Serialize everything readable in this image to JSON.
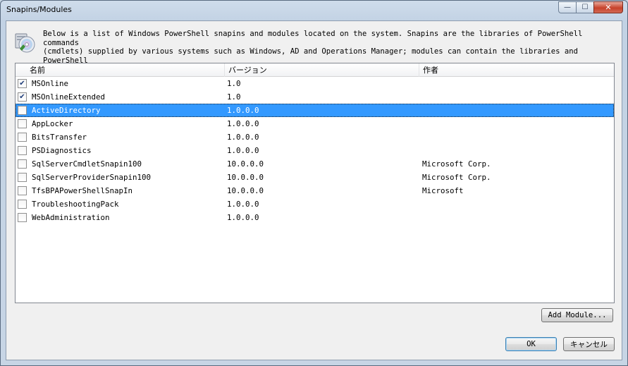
{
  "window": {
    "title": "Snapins/Modules",
    "minimize_glyph": "—",
    "maximize_glyph": "☐",
    "close_glyph": "✕"
  },
  "description": "Below is a list of Windows PowerShell snapins and modules located on the system. Snapins are the libraries of PowerShell commands\n(cmdlets) supplied by various systems such as Windows, AD and Operations Manager; modules can contain the libraries and PowerShell\nscripts as well. Please select the ones you want to be available in the tool.",
  "icon": "snapin-cd-icon",
  "list": {
    "columns": [
      "名前",
      "バージョン",
      "作者"
    ],
    "rows": [
      {
        "name": "MSOnline",
        "version": "1.0",
        "author": "",
        "checked": true,
        "selected": false
      },
      {
        "name": "MSOnlineExtended",
        "version": "1.0",
        "author": "",
        "checked": true,
        "selected": false
      },
      {
        "name": "ActiveDirectory",
        "version": "1.0.0.0",
        "author": "",
        "checked": false,
        "selected": true
      },
      {
        "name": "AppLocker",
        "version": "1.0.0.0",
        "author": "",
        "checked": false,
        "selected": false
      },
      {
        "name": "BitsTransfer",
        "version": "1.0.0.0",
        "author": "",
        "checked": false,
        "selected": false
      },
      {
        "name": "PSDiagnostics",
        "version": "1.0.0.0",
        "author": "",
        "checked": false,
        "selected": false
      },
      {
        "name": "SqlServerCmdletSnapin100",
        "version": "10.0.0.0",
        "author": "Microsoft Corp.",
        "checked": false,
        "selected": false
      },
      {
        "name": "SqlServerProviderSnapin100",
        "version": "10.0.0.0",
        "author": "Microsoft Corp.",
        "checked": false,
        "selected": false
      },
      {
        "name": "TfsBPAPowerShellSnapIn",
        "version": "10.0.0.0",
        "author": "Microsoft",
        "checked": false,
        "selected": false
      },
      {
        "name": "TroubleshootingPack",
        "version": "1.0.0.0",
        "author": "",
        "checked": false,
        "selected": false
      },
      {
        "name": "WebAdministration",
        "version": "1.0.0.0",
        "author": "",
        "checked": false,
        "selected": false
      }
    ]
  },
  "buttons": {
    "add_module": "Add Module...",
    "ok": "OK",
    "cancel": "キャンセル"
  },
  "colors": {
    "selection": "#3399ff",
    "check": "#1f3d7a"
  }
}
